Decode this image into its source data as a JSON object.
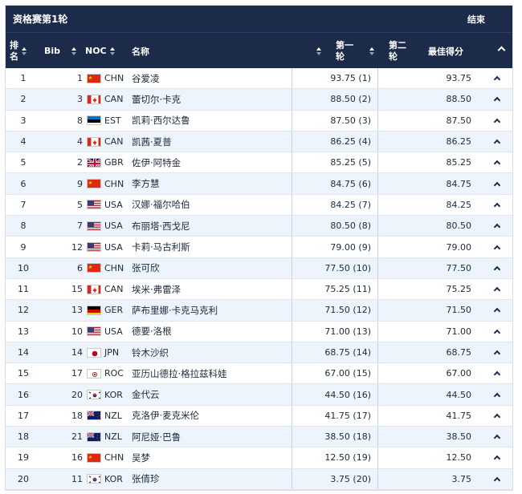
{
  "header": {
    "title": "资格赛第1轮",
    "status": "结束"
  },
  "columns": {
    "rank_line1": "排",
    "rank_line2": "名",
    "bib": "Bib",
    "noc": "NOC",
    "name": "名称",
    "run1_line1": "第一",
    "run1_line2": "轮",
    "run2_line1": "第二",
    "run2_line2": "轮",
    "best": "最佳得分"
  },
  "flags": {
    "CHN": "china-flag-icon",
    "CAN": "canada-flag-icon",
    "EST": "estonia-flag-icon",
    "GBR": "uk-flag-icon",
    "USA": "usa-flag-icon",
    "GER": "germany-flag-icon",
    "JPN": "japan-flag-icon",
    "ROC": "roc-flag-icon",
    "KOR": "korea-flag-icon",
    "NZL": "new-zealand-flag-icon"
  },
  "rows": [
    {
      "rank": "1",
      "bib": "1",
      "noc": "CHN",
      "name": "谷爱凌",
      "run1": "93.75 (1)",
      "best": "93.75"
    },
    {
      "rank": "2",
      "bib": "3",
      "noc": "CAN",
      "name": "蕾切尔·卡克",
      "run1": "88.50 (2)",
      "best": "88.50"
    },
    {
      "rank": "3",
      "bib": "8",
      "noc": "EST",
      "name": "凯莉·西尔达鲁",
      "run1": "87.50 (3)",
      "best": "87.50"
    },
    {
      "rank": "4",
      "bib": "4",
      "noc": "CAN",
      "name": "凯茜·夏普",
      "run1": "86.25 (4)",
      "best": "86.25"
    },
    {
      "rank": "5",
      "bib": "2",
      "noc": "GBR",
      "name": "佐伊·阿特金",
      "run1": "85.25 (5)",
      "best": "85.25"
    },
    {
      "rank": "6",
      "bib": "9",
      "noc": "CHN",
      "name": "李方慧",
      "run1": "84.75 (6)",
      "best": "84.75"
    },
    {
      "rank": "7",
      "bib": "5",
      "noc": "USA",
      "name": "汉娜·福尔哈伯",
      "run1": "84.25 (7)",
      "best": "84.25"
    },
    {
      "rank": "8",
      "bib": "7",
      "noc": "USA",
      "name": "布丽塔·西戈尼",
      "run1": "80.50 (8)",
      "best": "80.50"
    },
    {
      "rank": "9",
      "bib": "12",
      "noc": "USA",
      "name": "卡莉·马古利斯",
      "run1": "79.00 (9)",
      "best": "79.00"
    },
    {
      "rank": "10",
      "bib": "6",
      "noc": "CHN",
      "name": "张可欣",
      "run1": "77.50 (10)",
      "best": "77.50"
    },
    {
      "rank": "11",
      "bib": "15",
      "noc": "CAN",
      "name": "埃米·弗雷泽",
      "run1": "75.25 (11)",
      "best": "75.25"
    },
    {
      "rank": "12",
      "bib": "13",
      "noc": "GER",
      "name": "萨布里娜·卡克马克利",
      "run1": "71.50 (12)",
      "best": "71.50"
    },
    {
      "rank": "13",
      "bib": "10",
      "noc": "USA",
      "name": "德要·洛根",
      "run1": "71.00 (13)",
      "best": "71.00"
    },
    {
      "rank": "14",
      "bib": "14",
      "noc": "JPN",
      "name": "铃木沙织",
      "run1": "68.75 (14)",
      "best": "68.75"
    },
    {
      "rank": "15",
      "bib": "17",
      "noc": "ROC",
      "name": "亚历山德拉·格拉兹科娃",
      "run1": "67.00 (15)",
      "best": "67.00"
    },
    {
      "rank": "16",
      "bib": "20",
      "noc": "KOR",
      "name": "金代云",
      "run1": "44.50 (16)",
      "best": "44.50"
    },
    {
      "rank": "17",
      "bib": "18",
      "noc": "NZL",
      "name": "克洛伊·麦克米伦",
      "run1": "41.75 (17)",
      "best": "41.75"
    },
    {
      "rank": "18",
      "bib": "21",
      "noc": "NZL",
      "name": "阿尼娅·巴鲁",
      "run1": "38.50 (18)",
      "best": "38.50"
    },
    {
      "rank": "19",
      "bib": "16",
      "noc": "CHN",
      "name": "吴梦",
      "run1": "12.50 (19)",
      "best": "12.50"
    },
    {
      "rank": "20",
      "bib": "11",
      "noc": "KOR",
      "name": "张倩珍",
      "run1": "3.75 (20)",
      "best": "3.75"
    }
  ]
}
